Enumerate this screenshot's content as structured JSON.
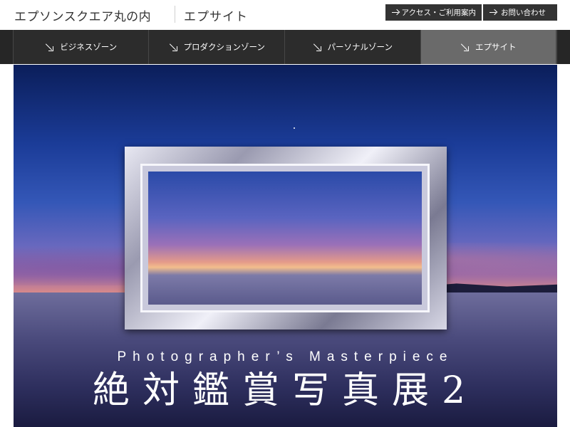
{
  "header": {
    "logo": "エプソンスクエア丸の内",
    "site_name": "エプサイト",
    "util_links": [
      {
        "label": "アクセス・ご利用案内",
        "icon": "arrow-right-icon"
      },
      {
        "label": "お問い合わせ",
        "icon": "arrow-right-icon"
      }
    ]
  },
  "nav": {
    "items": [
      {
        "label": "ビジネスゾーン",
        "icon": "arrow-down-right-icon",
        "active": false
      },
      {
        "label": "プロダクションゾーン",
        "icon": "arrow-down-right-icon",
        "active": false
      },
      {
        "label": "パーソナルゾーン",
        "icon": "arrow-down-right-icon",
        "active": false
      },
      {
        "label": "エプサイト",
        "icon": "arrow-down-right-icon",
        "active": true
      }
    ]
  },
  "hero": {
    "subtitle": "Photographer’s Masterpiece",
    "title": "絶対鑑賞写真展2"
  },
  "colors": {
    "nav_bg": "#2c2c2c",
    "nav_active": "#6a6a6a",
    "util_bg": "#333333"
  }
}
